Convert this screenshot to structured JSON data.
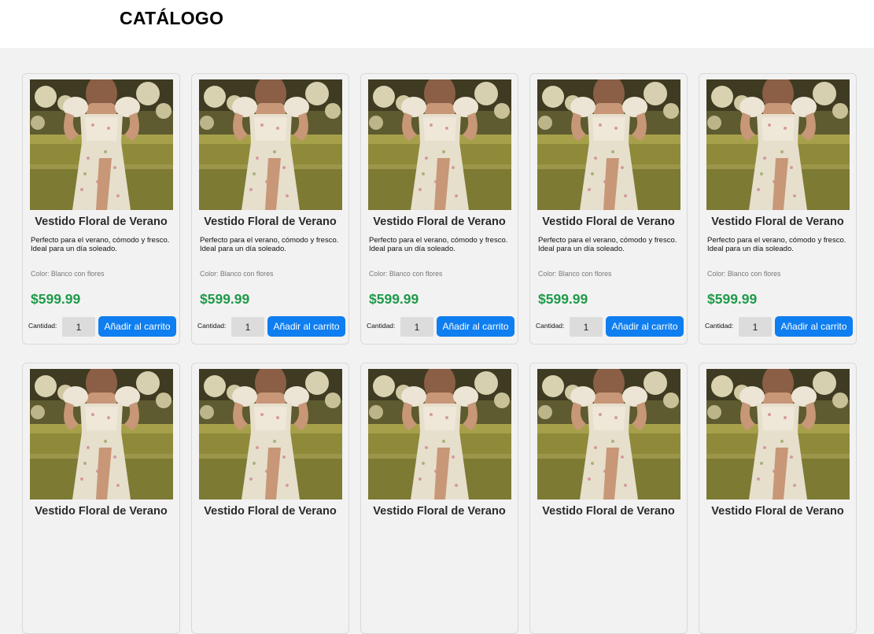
{
  "header": {
    "title": "CATÁLOGO"
  },
  "products": [
    {
      "title": "Vestido Floral de Verano",
      "description": "Perfecto para el verano, cómodo y fresco. Ideal para un día soleado.",
      "color": "Color: Blanco con flores",
      "price": "$599.99",
      "qty_label": "Cantidad:",
      "qty_value": "1",
      "button": "Añadir al carrito"
    },
    {
      "title": "Vestido Floral de Verano",
      "description": "Perfecto para el verano, cómodo y fresco. Ideal para un día soleado.",
      "color": "Color: Blanco con flores",
      "price": "$599.99",
      "qty_label": "Cantidad:",
      "qty_value": "1",
      "button": "Añadir al carrito"
    },
    {
      "title": "Vestido Floral de Verano",
      "description": "Perfecto para el verano, cómodo y fresco. Ideal para un día soleado.",
      "color": "Color: Blanco con flores",
      "price": "$599.99",
      "qty_label": "Cantidad:",
      "qty_value": "1",
      "button": "Añadir al carrito"
    },
    {
      "title": "Vestido Floral de Verano",
      "description": "Perfecto para el verano, cómodo y fresco. Ideal para un día soleado.",
      "color": "Color: Blanco con flores",
      "price": "$599.99",
      "qty_label": "Cantidad:",
      "qty_value": "1",
      "button": "Añadir al carrito"
    },
    {
      "title": "Vestido Floral de Verano",
      "description": "Perfecto para el verano, cómodo y fresco. Ideal para un día soleado.",
      "color": "Color: Blanco con flores",
      "price": "$599.99",
      "qty_label": "Cantidad:",
      "qty_value": "1",
      "button": "Añadir al carrito"
    },
    {
      "title": "Vestido Floral de Verano"
    },
    {
      "title": "Vestido Floral de Verano"
    },
    {
      "title": "Vestido Floral de Verano"
    },
    {
      "title": "Vestido Floral de Verano"
    },
    {
      "title": "Vestido Floral de Verano"
    }
  ],
  "colors": {
    "price": "#1f9a4a",
    "button": "#0e7ef0"
  }
}
